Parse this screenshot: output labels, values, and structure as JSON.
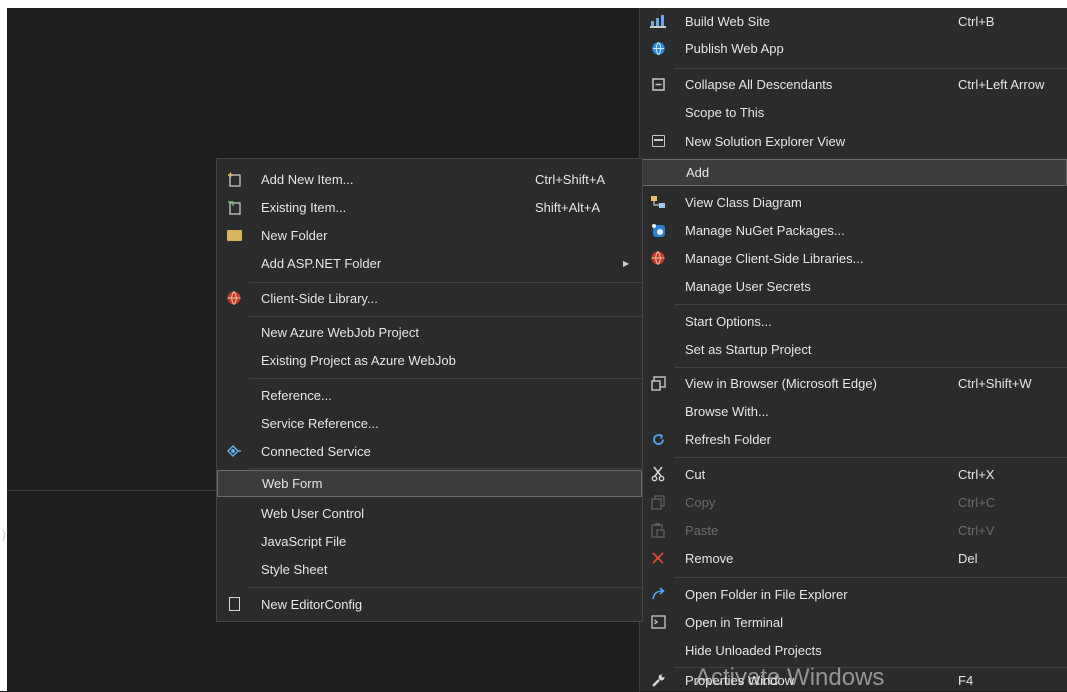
{
  "watermark": "Activate Windows",
  "stray_char": ")",
  "colors": {
    "menu_bg": "#2b2b2b",
    "selected_bg": "#3c3c3c",
    "disabled_text": "#6b6b6b",
    "remove_red": "#e0483c"
  },
  "context_menu": {
    "items": [
      {
        "label": "Build Web Site",
        "shortcut": "Ctrl+B",
        "icon": "build-icon"
      },
      {
        "label": "Publish Web App",
        "shortcut": "",
        "icon": "globe-icon"
      },
      {
        "label": "Collapse All Descendants",
        "shortcut": "Ctrl+Left Arrow",
        "icon": "collapse-icon"
      },
      {
        "label": "Scope to This",
        "shortcut": "",
        "icon": ""
      },
      {
        "label": "New Solution Explorer View",
        "shortcut": "",
        "icon": "explorer-view-icon"
      },
      {
        "label": "Add",
        "shortcut": "",
        "icon": ""
      },
      {
        "label": "View Class Diagram",
        "shortcut": "",
        "icon": "class-diagram-icon"
      },
      {
        "label": "Manage NuGet Packages...",
        "shortcut": "",
        "icon": "nuget-icon"
      },
      {
        "label": "Manage Client-Side Libraries...",
        "shortcut": "",
        "icon": "library-icon"
      },
      {
        "label": "Manage User Secrets",
        "shortcut": "",
        "icon": ""
      },
      {
        "label": "Start Options...",
        "shortcut": "",
        "icon": ""
      },
      {
        "label": "Set as Startup Project",
        "shortcut": "",
        "icon": ""
      },
      {
        "label": "View in Browser (Microsoft Edge)",
        "shortcut": "Ctrl+Shift+W",
        "icon": "browser-icon"
      },
      {
        "label": "Browse With...",
        "shortcut": "",
        "icon": ""
      },
      {
        "label": "Refresh Folder",
        "shortcut": "",
        "icon": "refresh-icon"
      },
      {
        "label": "Cut",
        "shortcut": "Ctrl+X",
        "icon": "scissors-icon"
      },
      {
        "label": "Copy",
        "shortcut": "Ctrl+C",
        "icon": "copy-icon"
      },
      {
        "label": "Paste",
        "shortcut": "Ctrl+V",
        "icon": "paste-icon"
      },
      {
        "label": "Remove",
        "shortcut": "Del",
        "icon": "remove-icon"
      },
      {
        "label": "Open Folder in File Explorer",
        "shortcut": "",
        "icon": "open-folder-icon"
      },
      {
        "label": "Open in Terminal",
        "shortcut": "",
        "icon": "terminal-icon"
      },
      {
        "label": "Hide Unloaded Projects",
        "shortcut": "",
        "icon": ""
      },
      {
        "label": "Properties Window",
        "shortcut": "F4",
        "icon": "wrench-icon"
      }
    ]
  },
  "add_submenu": {
    "items": [
      {
        "label": "Add New Item...",
        "shortcut": "Ctrl+Shift+A",
        "icon": "new-item-icon"
      },
      {
        "label": "Existing Item...",
        "shortcut": "Shift+Alt+A",
        "icon": "existing-item-icon"
      },
      {
        "label": "New Folder",
        "shortcut": "",
        "icon": "folder-icon"
      },
      {
        "label": "Add ASP.NET Folder",
        "shortcut": "",
        "icon": ""
      },
      {
        "label": "Client-Side Library...",
        "shortcut": "",
        "icon": "library-icon"
      },
      {
        "label": "New Azure WebJob Project",
        "shortcut": "",
        "icon": ""
      },
      {
        "label": "Existing Project as Azure WebJob",
        "shortcut": "",
        "icon": ""
      },
      {
        "label": "Reference...",
        "shortcut": "",
        "icon": ""
      },
      {
        "label": "Service Reference...",
        "shortcut": "",
        "icon": ""
      },
      {
        "label": "Connected Service",
        "shortcut": "",
        "icon": "connected-service-icon"
      },
      {
        "label": "Web Form",
        "shortcut": "",
        "icon": ""
      },
      {
        "label": "Web User Control",
        "shortcut": "",
        "icon": ""
      },
      {
        "label": "JavaScript File",
        "shortcut": "",
        "icon": ""
      },
      {
        "label": "Style Sheet",
        "shortcut": "",
        "icon": ""
      },
      {
        "label": "New EditorConfig",
        "shortcut": "",
        "icon": "page-icon"
      }
    ]
  }
}
